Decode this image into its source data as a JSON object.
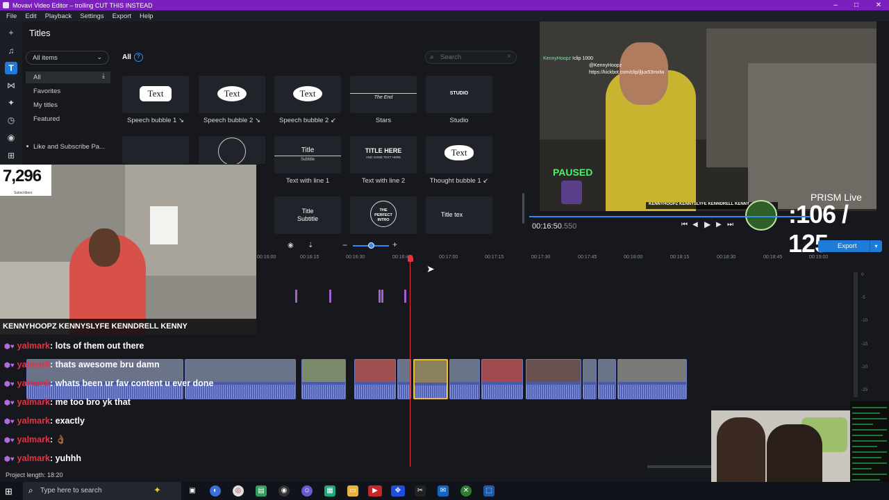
{
  "window": {
    "title": "Movavi Video Editor – trolling CUT THIS INSTEAD"
  },
  "menu": [
    "File",
    "Edit",
    "Playback",
    "Settings",
    "Export",
    "Help"
  ],
  "titles_panel": {
    "heading": "Titles",
    "filter_selected": "All items",
    "all_label": "All",
    "search_placeholder": "Search",
    "categories": [
      "All",
      "Favorites",
      "My titles",
      "Featured",
      "Like and Subscribe Pa..."
    ],
    "tiles": [
      {
        "label": "Speech bubble 1 ↘",
        "sample": "Text"
      },
      {
        "label": "Speech bubble 2 ↘",
        "sample": "Text"
      },
      {
        "label": "Speech bubble 2 ↙",
        "sample": "Text"
      },
      {
        "label": "Stars",
        "sample": "The End"
      },
      {
        "label": "Studio",
        "sample": "STUDIO"
      },
      {
        "label": "Text with line 1",
        "sample": "Title",
        "sample2": "Subtitle"
      },
      {
        "label": "Text with line 2",
        "sample": "TITLE HERE",
        "sample2": "AND SOME TEXT HERE"
      },
      {
        "label": "Thought bubble 1 ↙",
        "sample": "Text"
      },
      {
        "label": "",
        "sample": "Title",
        "sample2": "Subtitle"
      },
      {
        "label": "",
        "sample": "THE PERFECT INTRO"
      },
      {
        "label": "",
        "sample": "Title tex"
      }
    ]
  },
  "preview": {
    "overlay_chat": [
      "KennyHoopz",
      "!clip 1000",
      "@KennyHoopz",
      "https://kickbot.com/clip/jljux53mxlw"
    ],
    "paused_text": "PAUSED",
    "prism_text": "PRISM Live",
    "counter": ":106 / 125",
    "timecode": "00:16:50",
    "timecode_ms": ".550"
  },
  "export_button": "Export",
  "timeline": {
    "ticks": [
      "00:16:00",
      "00:16:15",
      "00:16:30",
      "00:16:45",
      "00:17:00",
      "00:17:15",
      "00:17:30",
      "00:17:45",
      "00:18:00",
      "00:18:15",
      "00:18:30",
      "00:18:45",
      "00:19:00"
    ],
    "db_scale": [
      "0",
      "-5",
      "-10",
      "-15",
      "-20",
      "-25"
    ],
    "project_length": "Project length: 18:20"
  },
  "webcam": {
    "subscribers": "7,296",
    "subscribers_label": "Subscribers",
    "socials": "KENNYHOOPZ  KENNYSLYFE  KENNDRELL  KENNY"
  },
  "chat": [
    {
      "user": "yalmark",
      "message": ": lots of them out there"
    },
    {
      "user": "yalmark",
      "message": ": thats awesome bru damn"
    },
    {
      "user": "yalmark",
      "message": ": whats been ur fav content u ever done"
    },
    {
      "user": "yalmark",
      "message": ": me too bro yk that"
    },
    {
      "user": "yalmark",
      "message": ": exactly"
    },
    {
      "user": "yalmark",
      "message": ": 👌🏾"
    },
    {
      "user": "yalmark",
      "message": ": yuhhh"
    }
  ],
  "taskbar": {
    "search_placeholder": "Type here to search"
  },
  "colors": {
    "accent": "#1f7bd8",
    "titlebar": "#7b1fbf",
    "playhead": "#e0353f",
    "username": "#e8323f"
  }
}
